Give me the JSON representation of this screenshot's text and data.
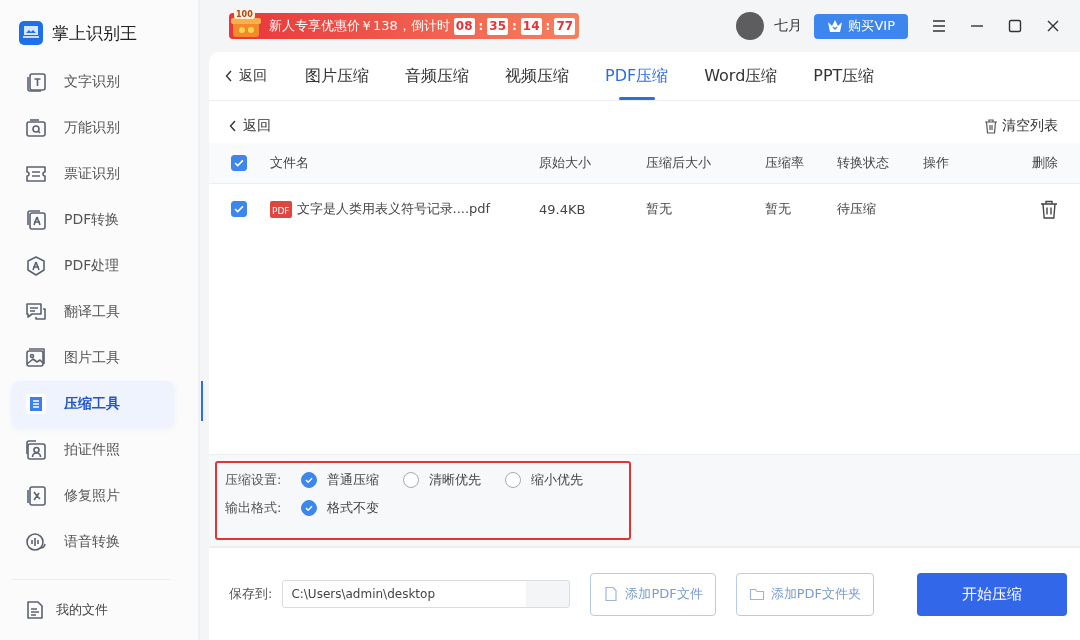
{
  "app": {
    "title": "掌上识别王"
  },
  "sidebar": {
    "items": [
      {
        "label": "文字识别",
        "selected": false
      },
      {
        "label": "万能识别",
        "selected": false
      },
      {
        "label": "票证识别",
        "selected": false
      },
      {
        "label": "PDF转换",
        "selected": false
      },
      {
        "label": "PDF处理",
        "selected": false
      },
      {
        "label": "翻译工具",
        "selected": false
      },
      {
        "label": "图片工具",
        "selected": false
      },
      {
        "label": "压缩工具",
        "selected": true
      },
      {
        "label": "拍证件照",
        "selected": false
      },
      {
        "label": "修复照片",
        "selected": false
      },
      {
        "label": "语音转换",
        "selected": false
      }
    ],
    "footer": {
      "label": "我的文件"
    }
  },
  "promo": {
    "badge": "100",
    "text": "新人专享优惠价￥138，倒计时",
    "countdown": [
      {
        "digits": "08"
      },
      {
        "separator": ":",
        "digits": "35"
      },
      {
        "separator": ":",
        "digits": "14"
      },
      {
        "separator": ":",
        "digits": "77"
      }
    ]
  },
  "user": {
    "name": "七月",
    "vip_button": "购买VIP"
  },
  "tabs": {
    "back": "返回",
    "items": [
      {
        "label": "图片压缩",
        "selected": false
      },
      {
        "label": "音频压缩",
        "selected": false
      },
      {
        "label": "视频压缩",
        "selected": false
      },
      {
        "label": "PDF压缩",
        "selected": true
      },
      {
        "label": "Word压缩",
        "selected": false
      },
      {
        "label": "PPT压缩",
        "selected": false
      }
    ]
  },
  "toolbar": {
    "back": "返回",
    "clear": "清空列表"
  },
  "table": {
    "all_checked": true,
    "columns": [
      "文件名",
      "原始大小",
      "压缩后大小",
      "压缩率",
      "转换状态",
      "操作",
      "删除"
    ],
    "rows": [
      {
        "checked": true,
        "file_badge": "PDF",
        "file_name": "文字是人类用表义符号记录....pdf",
        "original_size": "49.4KB",
        "compressed_size": "暂无",
        "ratio": "暂无",
        "status": "待压缩"
      }
    ]
  },
  "settings": {
    "highlighted": true,
    "groups": [
      {
        "label": "压缩设置:",
        "options": [
          {
            "label": "普通压缩",
            "selected": true
          },
          {
            "label": "清晰优先",
            "selected": false
          },
          {
            "label": "缩小优先",
            "selected": false
          }
        ]
      },
      {
        "label": "输出格式:",
        "options": [
          {
            "label": "格式不变",
            "selected": true
          }
        ]
      }
    ]
  },
  "output": {
    "label": "保存到:",
    "path": "C:\\Users\\admin\\desktop",
    "buttons": [
      {
        "label": "添加PDF文件",
        "kind": "outline"
      },
      {
        "label": "添加PDF文件夹",
        "kind": "outline"
      },
      {
        "label": "开始压缩",
        "kind": "primary"
      }
    ]
  }
}
